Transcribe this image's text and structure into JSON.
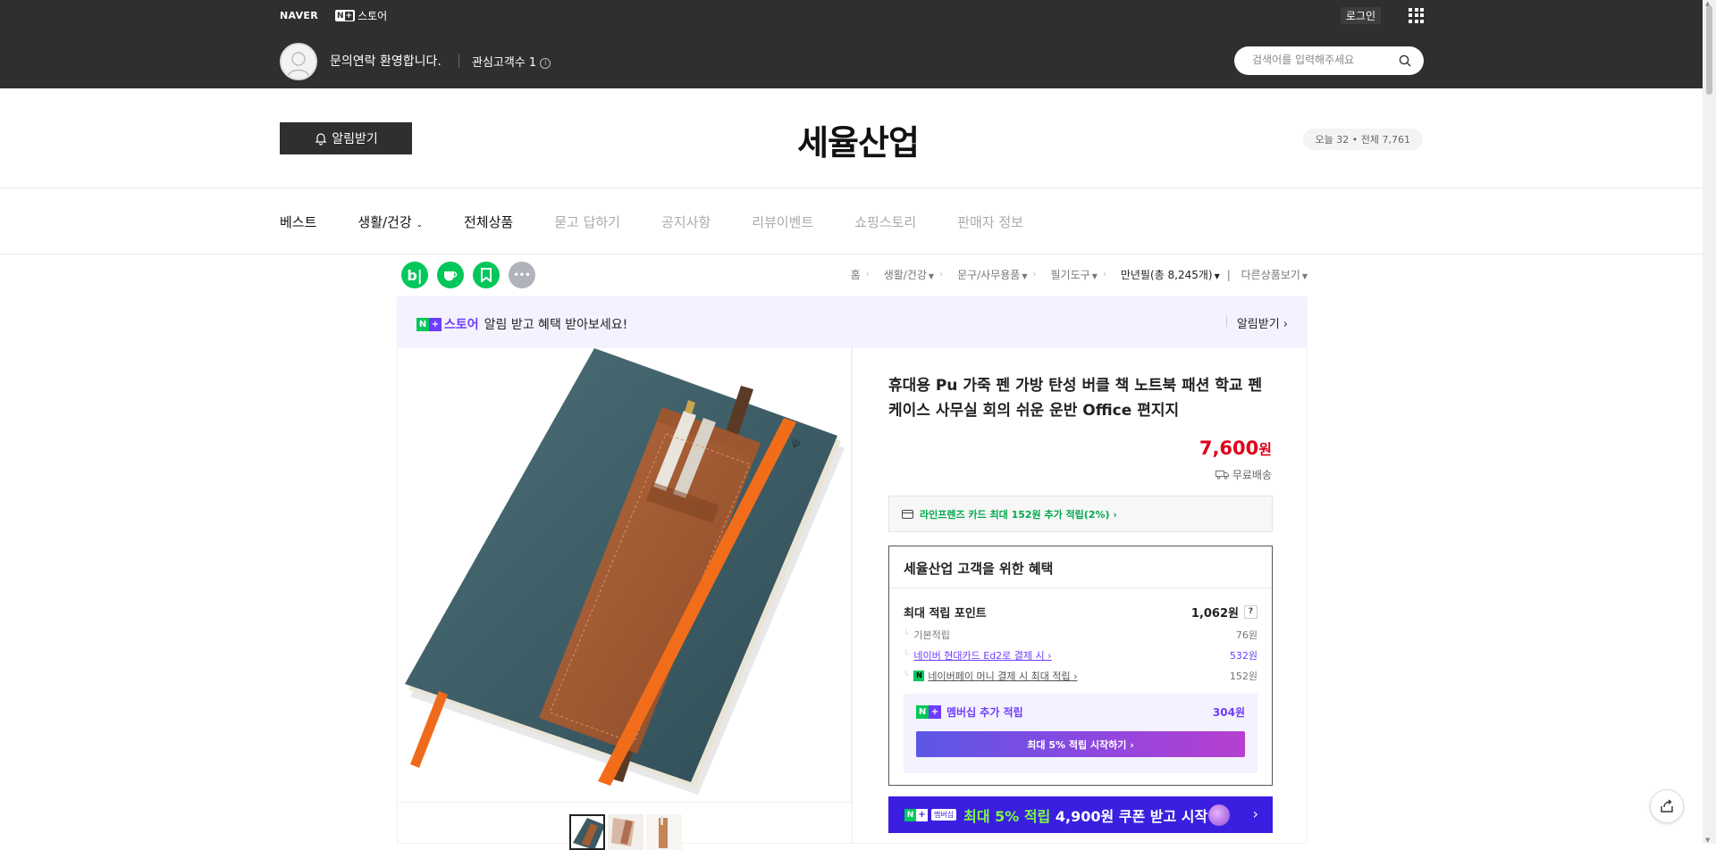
{
  "header": {
    "naver_logo": "NAVER",
    "nstore_badge_n": "N",
    "nstore_badge_plus": "+",
    "nstore_label": "스토어",
    "login": "로그인",
    "welcome": "문의연락 환영합니다.",
    "interest": "관심고객수 1",
    "search_placeholder": "검색어를 입력해주세요"
  },
  "store": {
    "alarm_button": "알림받기",
    "name": "세율산업",
    "visitors": "오늘 32 • 전체 7,761"
  },
  "nav": {
    "items": [
      "베스트",
      "생활/건강",
      "전체상품",
      "묻고 답하기",
      "공지사항",
      "리뷰이벤트",
      "쇼핑스토리",
      "판매자 정보"
    ]
  },
  "share": {
    "blog": "b|",
    "cafe": "☕",
    "bookmark": "",
    "more": "•••"
  },
  "breadcrumb": {
    "home": "홈",
    "items": [
      "생활/건강",
      "문구/사무용품",
      "필기도구",
      "만년필(총 8,245개)",
      "다른상품보기"
    ]
  },
  "notice": {
    "badge_n": "N",
    "badge_plus": "+",
    "store": "스토어",
    "text": "알림 받고 혜택 받아보세요!",
    "right": "알림받기 ›"
  },
  "product": {
    "title": "휴대용 Pu 가죽 펜 가방 탄성 버클 책 노트북 패션 학교 펜 케이스 사무실 회의 쉬운 운반 Office 편지지",
    "price": "7,600",
    "price_unit": "원",
    "shipping": "무료배송",
    "card_benefit": "라인프렌즈 카드 최대 152원 추가 적립(2%) ›",
    "benefit_title": "세율산업 고객을 위한 혜택",
    "max_point_label": "최대 적립 포인트",
    "max_point_value": "1,062원",
    "qmark": "?",
    "basic_label": "기본적립",
    "basic_value": "76원",
    "card_label": "네이버 현대카드 Ed2로 결제 시 ›",
    "card_value": "532원",
    "npay_label": "네이버페이 머니 결제 시 최대 적립 ›",
    "npay_value": "152원",
    "npay_mini": "N",
    "member_label": "멤버십 추가 적립",
    "member_value": "304원",
    "member_button": "최대 5% 적립 시작하기 ›",
    "promo_tag_n": "N",
    "promo_tag_p": "+",
    "promo_tag_m": "멤버십",
    "promo_text_hl": "최대 5% 적립",
    "promo_text_rest": " 4,900원 쿠폰 받고 시작",
    "promo_arrow": "›"
  },
  "colors": {
    "topbar": "#2f2f2f",
    "naver_green": "#03c75a",
    "membership_purple": "#6d3dff",
    "price_red": "#e0001a",
    "promo_blue": "#3a1fe0"
  },
  "icons": [
    "apps-icon",
    "search-icon",
    "bell-icon",
    "info-icon",
    "truck-icon",
    "card-icon",
    "share-icon"
  ]
}
